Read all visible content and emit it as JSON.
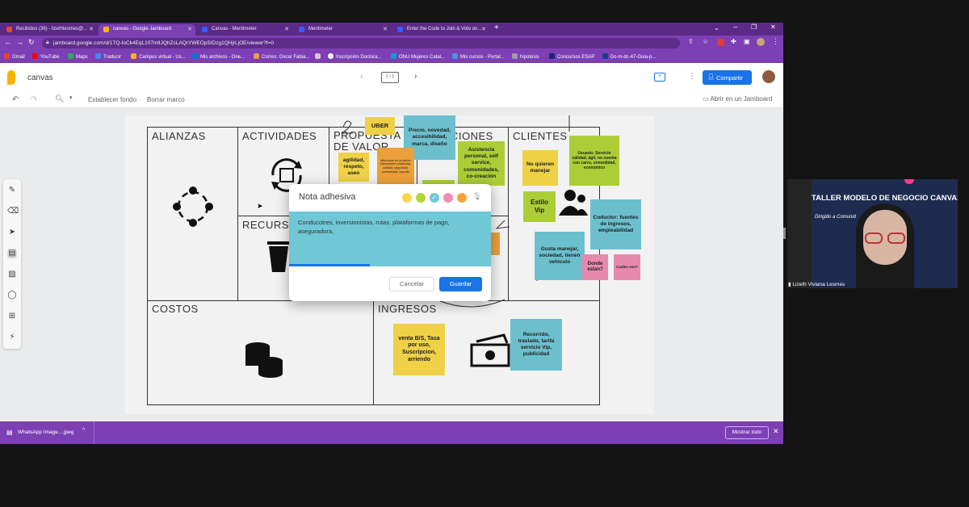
{
  "tabs": [
    {
      "title": "Recibidos (36) - lizethlesmes@...",
      "color": "#ea4335"
    },
    {
      "title": "canvas - Google Jamboard",
      "color": "#f4b400"
    },
    {
      "title": "Canvas - Mentimeter",
      "color": "#3d5afe"
    },
    {
      "title": "Mentimeter",
      "color": "#3d5afe"
    },
    {
      "title": "Enter the Code to Join & Vote on...",
      "color": "#3d5afe"
    }
  ],
  "url": "jamboard.google.com/d/1TQ-IoCk4EqL107mlIJQhZcLAQrYWEOpSIDzg1QHjrLjOE/viewer?f=0",
  "bookmarks": [
    "Gmail",
    "YouTube",
    "Maps",
    "Traducir",
    "Campus virtual - Us...",
    "Mis archivos - One...",
    "Correo: Oscar Fabia...",
    "Inscripción Doctora...",
    "ONU Mujeres Catal...",
    "Mis cursos - Portal...",
    "hipotesis",
    "Concursos ESAP",
    "Dc-m-dc-47-Guia-p..."
  ],
  "app": {
    "title": "canvas",
    "frame_counter": "1 / 1",
    "share_label": "Compartir",
    "set_background": "Establecer fondo",
    "clear_frame": "Borrar marco",
    "open_in_jamboard": "Abrir en un Jamboard"
  },
  "canvas": {
    "sections": {
      "alianzas": "ALIANZAS",
      "actividades": "ACTIVIDADES",
      "propuesta": "PROPUESTA DE VALOR",
      "relaciones": "RELACIONES",
      "clientes": "CLIENTES",
      "recursos": "RECURSOS",
      "costos": "COSTOS",
      "ingresos": "INGRESOS"
    },
    "notes": {
      "uber": "UBER",
      "precio": "Precio, novedad, accesibilidad, marca, diseño",
      "asistencia": "Asistencia personal, self service, comunidades, co-creación",
      "agilidad": "agilidad, respeto, aseo",
      "diferencia": "diferencia en la oferta: información producida, calidad, seguridad, puntualidad, soporte",
      "no_quieren": "No quieren manejar",
      "usuario": "Usuario: Servicio calidad, ágil, no cuenta con carro, comodidad, económico",
      "estilo": "Estilo Vip",
      "conductor": "Coductor: fuentes de ingresos, empleabilidad",
      "gusta": "Gusta manejar, sociedad, tienen vehiculo",
      "donde": "Donde estan?",
      "cuales": "Cuáles son?",
      "venta": "venta B/S, Tasa por uso, Suscripcion, arriendo",
      "recorrido": "Recorrido, traslado, tarifa servicio Vip, publicidad"
    }
  },
  "dialog": {
    "title": "Nota adhesiva",
    "text": "Conducotres, inversionistas, rutas, plataformas de pago, aseguradora,",
    "cancel": "Cancelar",
    "save": "Guardar",
    "swatches": [
      "#f7d84a",
      "#b3d439",
      "#70c7d5",
      "#ef8eb2",
      "#f4a63b"
    ],
    "selected_swatch": 2
  },
  "downloads": {
    "file": "WhatsApp Image....jpeg",
    "show_all": "Mostrar todo"
  },
  "video": {
    "participant": "Lizeth Viviana Lesmes",
    "banner": "TALLER MODELO DE NEGOCIO CANVAS",
    "sub": "Dirigido a Comunid"
  }
}
